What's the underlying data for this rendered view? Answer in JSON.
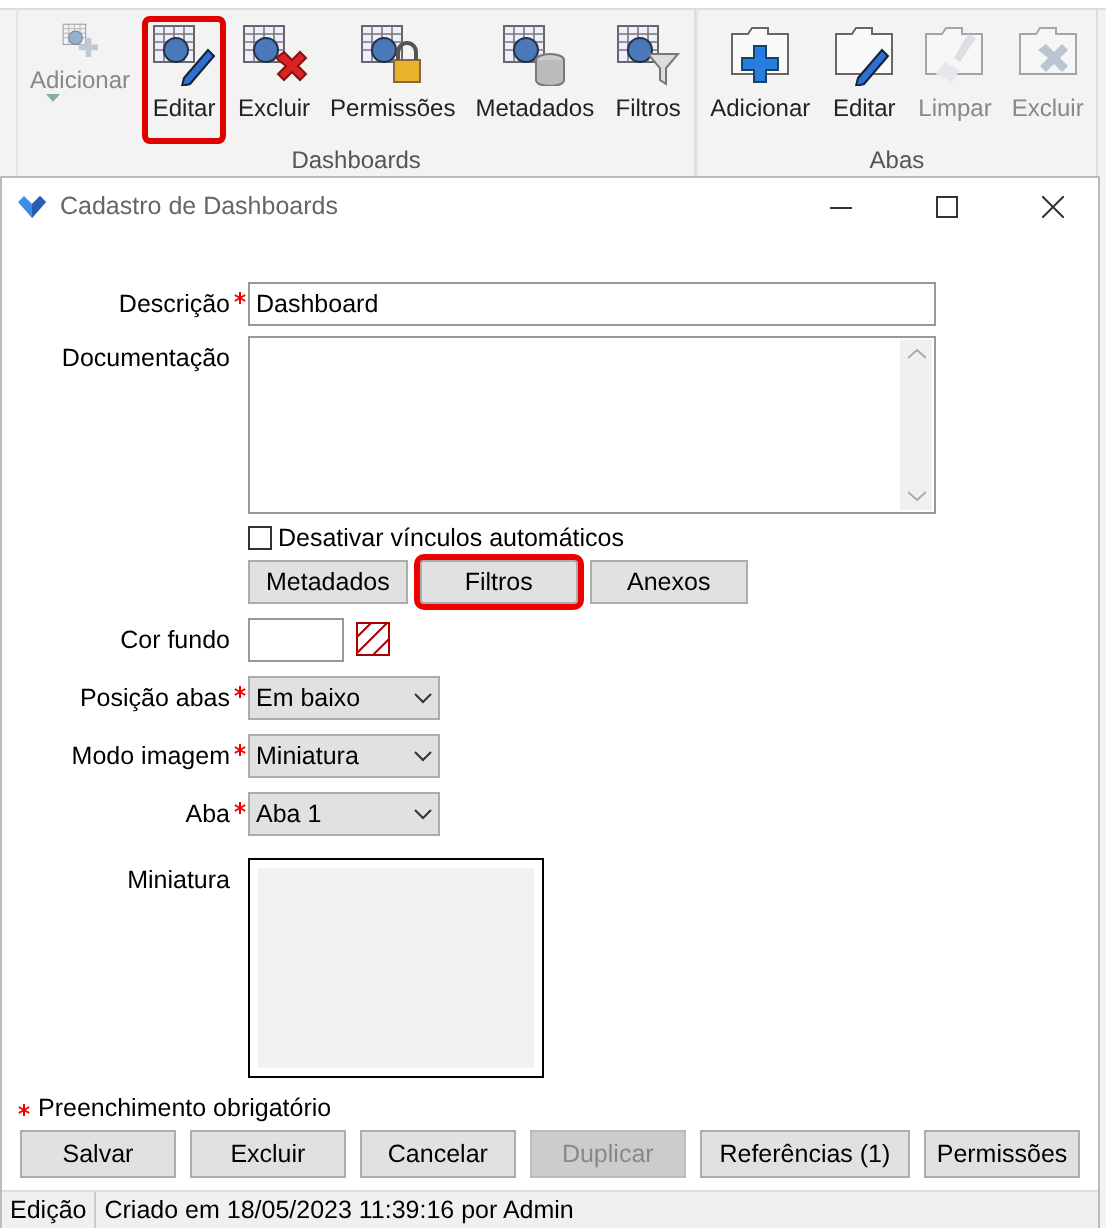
{
  "ribbon": {
    "groups": [
      {
        "label": "Dashboards",
        "buttons": [
          {
            "label": "Adicionar",
            "kind": "add",
            "disabled": true,
            "dropdown": true,
            "highlighted": false
          },
          {
            "label": "Editar",
            "kind": "edit",
            "disabled": false,
            "dropdown": false,
            "highlighted": true
          },
          {
            "label": "Excluir",
            "kind": "delete",
            "disabled": false,
            "dropdown": false,
            "highlighted": false
          },
          {
            "label": "Permissões",
            "kind": "lock",
            "disabled": false,
            "dropdown": false,
            "highlighted": false
          },
          {
            "label": "Metadados",
            "kind": "database",
            "disabled": false,
            "dropdown": false,
            "highlighted": false
          },
          {
            "label": "Filtros",
            "kind": "filter",
            "disabled": false,
            "dropdown": false,
            "highlighted": false
          }
        ]
      },
      {
        "label": "Abas",
        "buttons": [
          {
            "label": "Adicionar",
            "kind": "tab-add",
            "disabled": false,
            "dropdown": false,
            "highlighted": false
          },
          {
            "label": "Editar",
            "kind": "tab-edit",
            "disabled": false,
            "dropdown": false,
            "highlighted": false
          },
          {
            "label": "Limpar",
            "kind": "tab-clear",
            "disabled": true,
            "dropdown": false,
            "highlighted": false
          },
          {
            "label": "Excluir",
            "kind": "tab-delete",
            "disabled": true,
            "dropdown": false,
            "highlighted": false
          }
        ]
      }
    ]
  },
  "window": {
    "title": "Cadastro de Dashboards"
  },
  "form": {
    "description": {
      "label": "Descrição",
      "required": true,
      "value": "Dashboard"
    },
    "documentation": {
      "label": "Documentação"
    },
    "auto_links": {
      "label": "Desativar vínculos automáticos",
      "checked": false
    },
    "tab_buttons": [
      {
        "label": "Metadados",
        "highlighted": false
      },
      {
        "label": "Filtros",
        "highlighted": true
      },
      {
        "label": "Anexos",
        "highlighted": false
      }
    ],
    "background_color": {
      "label": "Cor fundo"
    },
    "selects": [
      {
        "label": "Posição abas",
        "required": true,
        "value": "Em baixo"
      },
      {
        "label": "Modo imagem",
        "required": true,
        "value": "Miniatura"
      },
      {
        "label": "Aba",
        "required": true,
        "value": "Aba 1"
      }
    ],
    "thumbnail": {
      "label": "Miniatura"
    },
    "required_note": "Preenchimento obrigatório"
  },
  "buttons": [
    {
      "label": "Salvar",
      "disabled": false
    },
    {
      "label": "Excluir",
      "disabled": false
    },
    {
      "label": "Cancelar",
      "disabled": false
    },
    {
      "label": "Duplicar",
      "disabled": true
    },
    {
      "label": "Referências (1)",
      "disabled": false
    },
    {
      "label": "Permissões",
      "disabled": false
    }
  ],
  "status_bar": {
    "mode": "Edição",
    "info": "Criado em 18/05/2023 11:39:16 por Admin"
  }
}
